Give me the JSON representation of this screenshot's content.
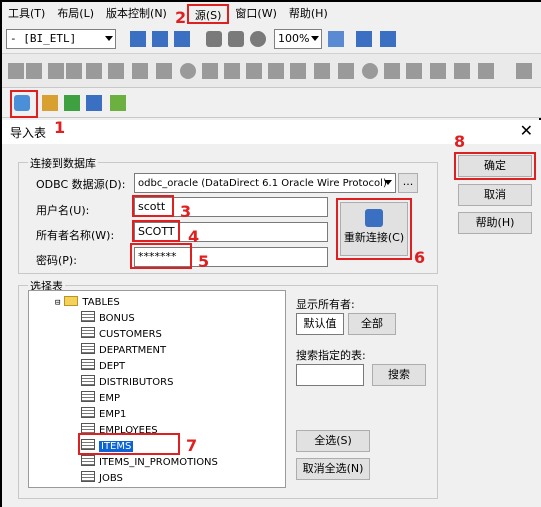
{
  "menu": [
    {
      "label": "工具(T)"
    },
    {
      "label": "布局(L)"
    },
    {
      "label": "版本控制(N)"
    },
    {
      "label": "源(S)"
    },
    {
      "label": "窗口(W)"
    },
    {
      "label": "帮助(H)"
    }
  ],
  "toolbar": {
    "folder_combo": "- [BI_ETL]",
    "zoom_combo": "100%",
    "source_toolbar_icons": [
      "import-source-icon",
      "create-source-icon",
      "edit-source-icon",
      "grid-icon",
      "extra-icon"
    ]
  },
  "dialog": {
    "title": "导入表",
    "close": "✕",
    "connect_group": "连接到数据库",
    "dsn_label": "ODBC 数据源(D):",
    "dsn_value": "odbc_oracle (DataDirect 6.1 Oracle Wire Protocol)",
    "dsn_more": "...",
    "user_label": "用户名(U):",
    "user_value": "scott",
    "owner_label": "所有者名称(W):",
    "owner_value": "SCOTT",
    "password_label": "密码(P):",
    "password_value": "*******",
    "reconnect_label": "重新连接(C)",
    "ok_label": "确定",
    "cancel_label": "取消",
    "help_label": "帮助(H)",
    "select_group": "选择表",
    "show_owners_label": "显示所有者:",
    "default_label": "默认值",
    "all_label": "全部",
    "search_label": "搜索指定的表:",
    "search_value": "",
    "search_button": "搜索",
    "select_all": "全选(S)",
    "deselect_all": "取消全选(N)"
  },
  "tree": {
    "root": "TABLES",
    "items": [
      "BONUS",
      "CUSTOMERS",
      "DEPARTMENT",
      "DEPT",
      "DISTRIBUTORS",
      "EMP",
      "EMP1",
      "EMPLOYEES",
      "ITEMS",
      "ITEMS_IN_PROMOTIONS",
      "JOBS"
    ],
    "selected": "ITEMS"
  },
  "annotations": [
    "1",
    "2",
    "3",
    "4",
    "5",
    "6",
    "7",
    "8"
  ],
  "colors": {
    "annotation": "#e02020",
    "selection": "#0a64d8"
  }
}
